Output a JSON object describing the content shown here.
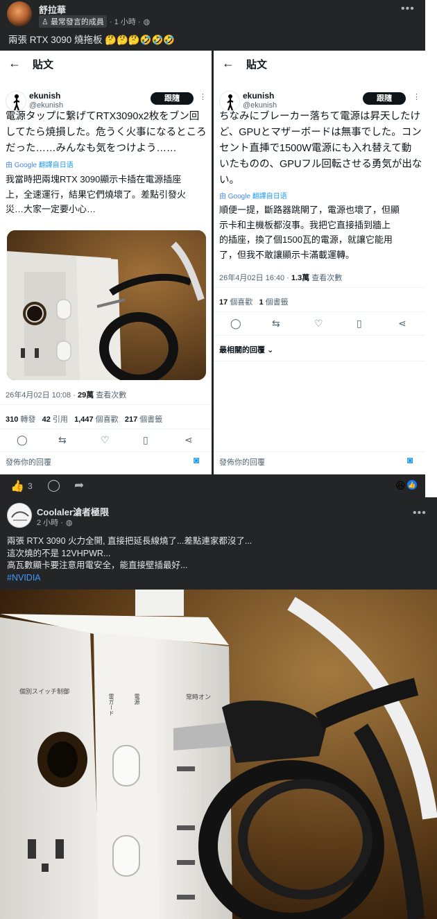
{
  "post1": {
    "author": "舒拉華",
    "badge": "最常發言的成員",
    "time": "· 1 小時 ·",
    "text": "兩張 RTX 3090 燒拖板 🤔🤔🤔🤣🤣🤣"
  },
  "tweet_left": {
    "header_title": "貼文",
    "name": "ekunish",
    "handle": "@ekunish",
    "follow_label": "跟隨",
    "jp_lines": [
      "電源タップに繋げてRTX3090x2枚をブン回",
      "してたら焼損した。危うく火事になるところ",
      "だった……みんなも気をつけよう……"
    ],
    "translate_label": "翻譯自日语",
    "google_label": "由 Google",
    "zh_lines": [
      "我當時把兩塊RTX 3090顯示卡插在電源插座",
      "上，全速運行，結果它們燒壞了。差點引發火",
      "災…大家一定要小心…"
    ],
    "time": "26年4月02日 10:08 · ",
    "views": "29萬",
    "views_label": " 查看次數",
    "stats": [
      {
        "num": "310",
        "label": "轉發"
      },
      {
        "num": "42",
        "label": "引用"
      },
      {
        "num": "1,447",
        "label": "個喜歡"
      },
      {
        "num": "217",
        "label": "個書籤"
      }
    ],
    "reply_placeholder": "發佈你的回覆"
  },
  "tweet_right": {
    "header_title": "貼文",
    "name": "ekunish",
    "handle": "@ekunish",
    "follow_label": "跟隨",
    "jp_lines": [
      "ちなみにブレーカー落ちて電源は昇天したけ",
      "ど、GPUとマザーボードは無事でした。コン",
      "セント直挿で1500W電源にも入れ替えて動",
      "いたものの、GPUフル回転させる勇気が出な",
      "い。"
    ],
    "translate_label": "翻譯自日语",
    "google_label": "由 Google",
    "zh_lines": [
      "順便一提，斷路器跳閘了，電源也壞了，但顯",
      "示卡和主機板都沒事。我把它直接插到牆上",
      "的插座，換了個1500瓦的電源，就讓它能用",
      "了，但我不敢讓顯示卡滿載運轉。"
    ],
    "time": "26年4月02日 16:40 · ",
    "views": "1.3萬",
    "views_label": " 查看次數",
    "stats": [
      {
        "num": "17",
        "label": "個喜歡"
      },
      {
        "num": "1",
        "label": "個書籤"
      }
    ],
    "sort_label": "最相關的回覆",
    "reply_placeholder": "發佈你的回覆"
  },
  "reactions": {
    "like_count": "3"
  },
  "post2": {
    "author": "Coolaler滄者極限",
    "time": "2 小時 ·",
    "lines": [
      "兩張 RTX 3090 火力全開, 直接把延長線燒了...差點連家都沒了...",
      "這次燒的不是 12VHPWR...",
      "高瓦數顯卡要注意用電安全，能直接壁插最好..."
    ],
    "hashtag": "#NVIDIA"
  },
  "photo_text": {
    "left_switch": "個別スイッチ制御",
    "right_switch": "常時オン",
    "label_a": "雷ガード",
    "label_b": "電源"
  }
}
